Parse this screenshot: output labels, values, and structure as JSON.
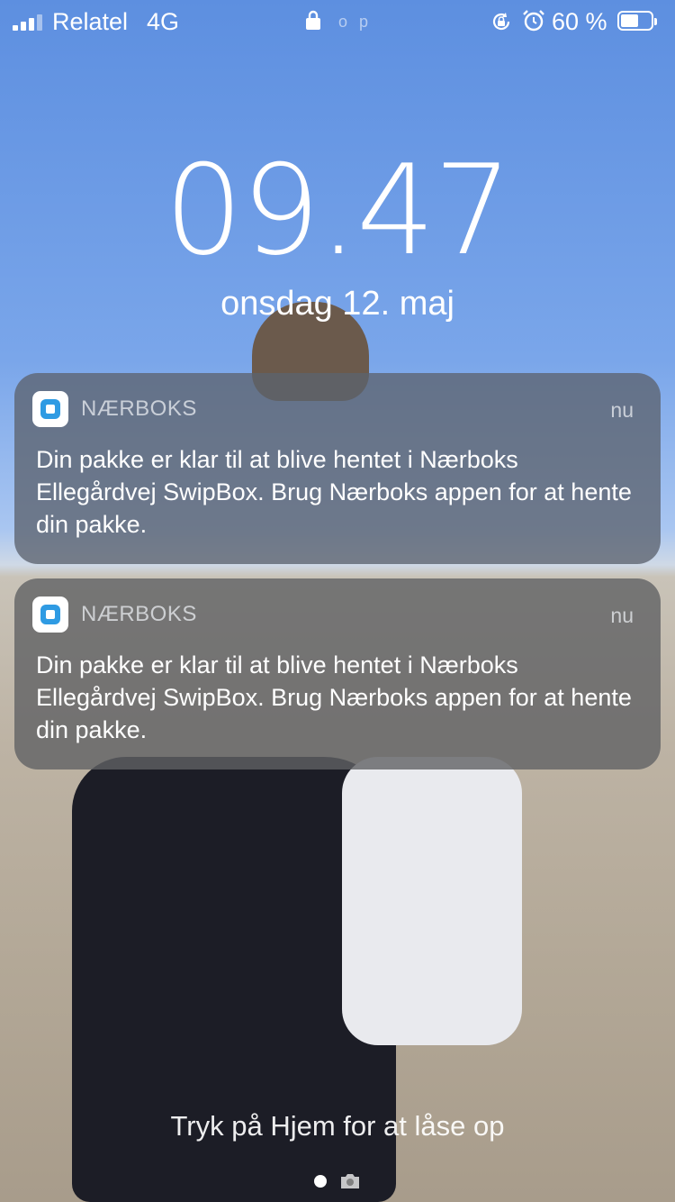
{
  "status_bar": {
    "carrier": "Relatel",
    "network": "4G",
    "center_text": "o p",
    "battery_percent": "60 %",
    "battery_level": 0.6,
    "icons": [
      "signal-icon",
      "lock-icon",
      "rotation-lock-icon",
      "alarm-icon",
      "battery-icon"
    ]
  },
  "lock_screen": {
    "time": "09.47",
    "date": "onsdag 12. maj"
  },
  "notifications": [
    {
      "app": "NÆRBOKS",
      "time": "nu",
      "message": "Din pakke er klar til at blive hentet i Nærboks Ellegårdvej SwipBox. Brug Nærboks appen for at hente din pakke."
    },
    {
      "app": "NÆRBOKS",
      "time": "nu",
      "message": "Din pakke er klar til at blive hentet i Nærboks Ellegårdvej SwipBox. Brug Nærboks appen for at hente din pakke."
    }
  ],
  "unlock_hint": "Tryk på Hjem for at låse op",
  "colors": {
    "app_icon_accent": "#2f9be3",
    "sky": "#6f9fe8",
    "sand": "#b3a897"
  }
}
